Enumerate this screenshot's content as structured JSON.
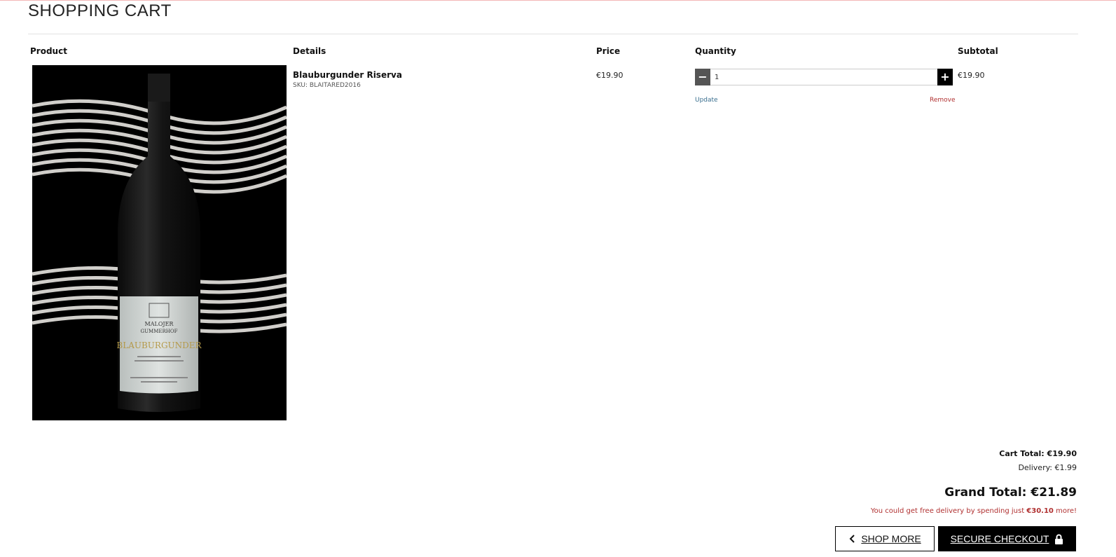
{
  "page": {
    "title": "SHOPPING CART"
  },
  "table": {
    "headers": {
      "product": "Product",
      "details": "Details",
      "price": "Price",
      "quantity": "Quantity",
      "subtotal": "Subtotal"
    }
  },
  "item": {
    "name": "Blauburgunder Riserva",
    "sku": "SKU: BLAITARED2016",
    "price": "€19.90",
    "quantity": "1",
    "subtotal": "€19.90",
    "update_label": "Update",
    "remove_label": "Remove",
    "image_label": {
      "brand_top": "MALOJER",
      "brand_bottom": "GUMMERHOF",
      "wine": "BLAUBURGUNDER"
    }
  },
  "summary": {
    "cart_total": "Cart Total: €19.90",
    "delivery": "Delivery: €1.99",
    "grand_total": "Grand Total: €21.89",
    "free_delivery_prefix": "You could get free delivery by spending just",
    "free_delivery_amount": "€30.10",
    "free_delivery_suffix": "more!"
  },
  "buttons": {
    "shop_more": "SHOP MORE",
    "secure_checkout": "SECURE CHECKOUT"
  },
  "icons": {
    "back": "chevron-left-icon",
    "lock": "lock-icon",
    "minus": "minus-icon",
    "plus": "plus-icon"
  },
  "colors": {
    "accent_red": "#b03030",
    "link_blue": "#3a6f8f",
    "primary": "#000000"
  }
}
